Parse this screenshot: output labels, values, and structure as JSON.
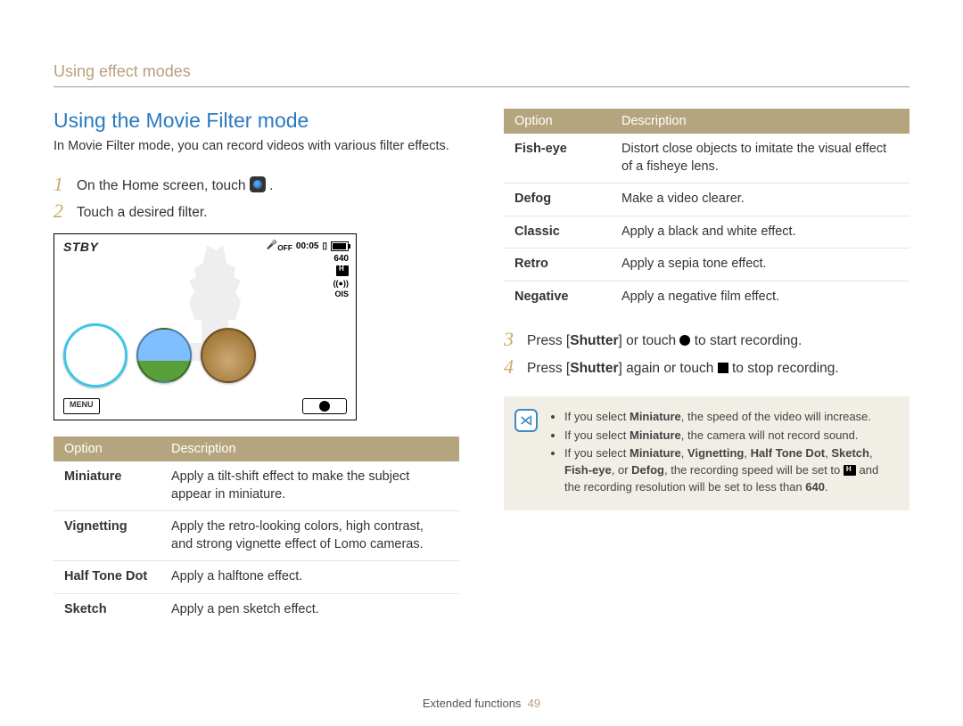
{
  "breadcrumb": "Using effect modes",
  "title": "Using the Movie Filter mode",
  "intro": "In Movie Filter mode, you can record videos with various filter effects.",
  "steps": {
    "1": "On the Home screen, touch",
    "2": "Touch a desired filter.",
    "3_pre": "Press [",
    "3_shutter": "Shutter",
    "3_mid": "] or touch ",
    "3_post": " to start recording.",
    "4_pre": "Press [",
    "4_shutter": "Shutter",
    "4_mid": "] again or touch ",
    "4_post": " to stop recording."
  },
  "camera": {
    "stby": "STBY",
    "time": "00:05",
    "res": "640",
    "off": "OFF",
    "menu": "MENU"
  },
  "table_headers": {
    "option": "Option",
    "description": "Description"
  },
  "table_left": [
    {
      "name": "Miniature",
      "desc": "Apply a tilt-shift effect to make the subject appear in miniature."
    },
    {
      "name": "Vignetting",
      "desc": "Apply the retro-looking colors, high contrast, and strong vignette effect of Lomo cameras."
    },
    {
      "name": "Half Tone Dot",
      "desc": "Apply a halftone effect."
    },
    {
      "name": "Sketch",
      "desc": "Apply a pen sketch effect."
    }
  ],
  "table_right": [
    {
      "name": "Fish-eye",
      "desc": "Distort close objects to imitate the visual effect of a fisheye lens."
    },
    {
      "name": "Defog",
      "desc": "Make a video clearer."
    },
    {
      "name": "Classic",
      "desc": "Apply a black and white effect."
    },
    {
      "name": "Retro",
      "desc": "Apply a sepia tone effect."
    },
    {
      "name": "Negative",
      "desc": "Apply a negative film effect."
    }
  ],
  "notes": {
    "n1_pre": "If you select ",
    "n1_b": "Miniature",
    "n1_post": ", the speed of the video will increase.",
    "n2_pre": "If you select ",
    "n2_b": "Miniature",
    "n2_post": ", the camera will not record sound.",
    "n3_pre": "If you select ",
    "n3_b1": "Miniature",
    "n3_b2": "Vignetting",
    "n3_b3": "Half Tone Dot",
    "n3_b4": "Sketch",
    "n3_b5": "Fish-eye",
    "n3_b6": "Defog",
    "n3_mid": ", the recording speed will be set to ",
    "n3_post1": " and the recording resolution will be set to less than ",
    "n3_res": "640",
    "n3_end": "."
  },
  "footer": {
    "section": "Extended functions",
    "page": "49"
  }
}
